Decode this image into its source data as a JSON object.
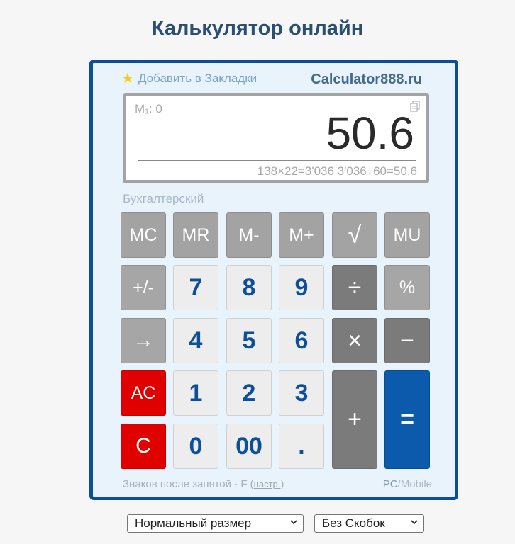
{
  "page": {
    "title": "Калькулятор онлайн"
  },
  "header": {
    "bookmark_label": "Добавить в Закладки",
    "brand": "Calculator888.ru"
  },
  "display": {
    "memory": "M₁: 0",
    "value": "50.6",
    "history": "138×22=3'036 3'036÷60=50.6"
  },
  "mode_label": "Бухгалтерский",
  "buttons": {
    "mc": "MC",
    "mr": "MR",
    "m_minus": "M-",
    "m_plus": "M+",
    "sqrt": "√",
    "mu": "MU",
    "plus_minus": "+/-",
    "n7": "7",
    "n8": "8",
    "n9": "9",
    "divide": "÷",
    "percent": "%",
    "backspace": "→",
    "n4": "4",
    "n5": "5",
    "n6": "6",
    "multiply": "×",
    "minus": "−",
    "ac": "AC",
    "n1": "1",
    "n2": "2",
    "n3": "3",
    "plus": "+",
    "equals": "=",
    "c": "C",
    "n0": "0",
    "n00": "00",
    "dot": "."
  },
  "footer": {
    "decimals_text": "Знаков после запятой - F (",
    "settings_link": "настр.",
    "decimals_close": ")",
    "pc": "PC",
    "separator": "/",
    "mobile": "Mobile"
  },
  "selects": {
    "size": "Нормальный размер",
    "brackets": "Без Скобок"
  },
  "colors": {
    "frame": "#0c4e97",
    "digit_text": "#0d4f99",
    "clear_red": "#e00000",
    "equals_blue": "#0b5aac",
    "operator_gray": "#7b7b7b",
    "memory_gray": "#a3a3a3"
  }
}
